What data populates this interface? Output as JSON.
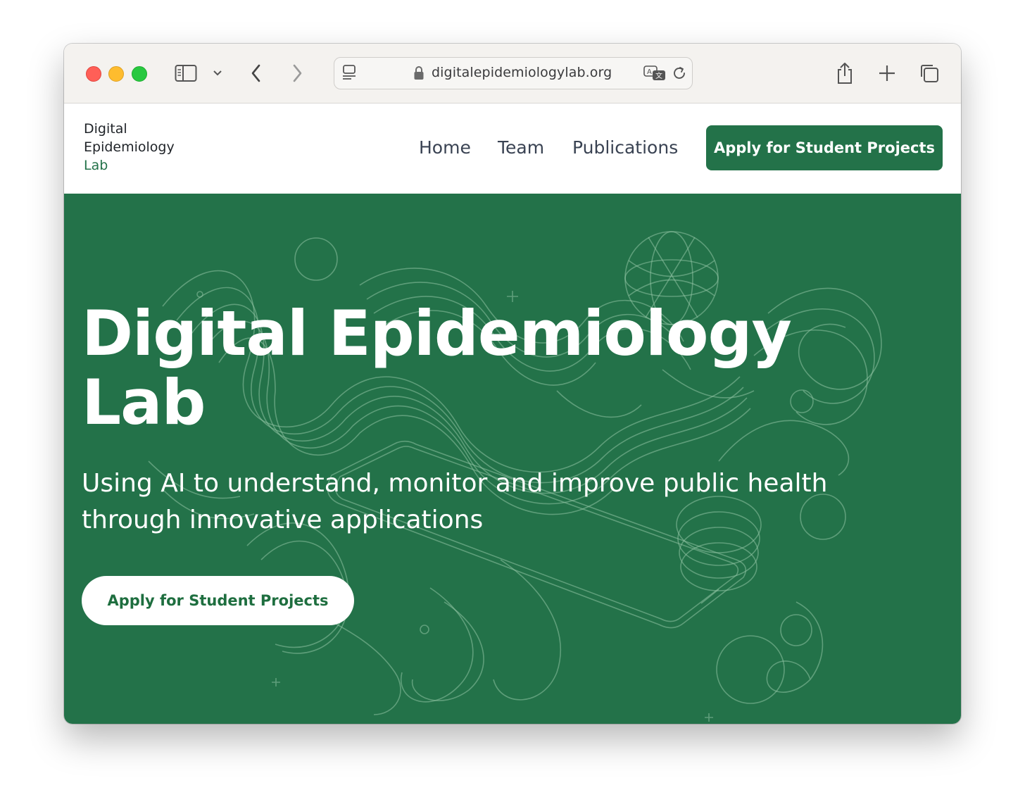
{
  "browser": {
    "url": "digitalepidemiologylab.org",
    "icons": [
      "sidebar-icon",
      "chevron-down-icon",
      "back-icon",
      "forward-icon",
      "reader-icon",
      "lock-icon",
      "translate-icon",
      "reload-icon",
      "share-icon",
      "new-tab-icon",
      "tabs-overview-icon"
    ]
  },
  "site": {
    "brand": {
      "line1": "Digital",
      "line2": "Epidemiology",
      "line3": "Lab"
    },
    "nav": [
      {
        "label": "Home"
      },
      {
        "label": "Team"
      },
      {
        "label": "Publications"
      }
    ],
    "nav_cta": "Apply for Student Projects"
  },
  "hero": {
    "title_line1": "Digital Epidemiology",
    "title_line2": "Lab",
    "subtitle_line1": "Using AI to understand, monitor and improve public health",
    "subtitle_line2": "through innovative applications",
    "cta": "Apply for Student Projects"
  },
  "colors": {
    "brand_green": "#237249",
    "hero_bg": "#237249",
    "nav_text": "#3a4353",
    "chrome_bg": "#f4f2ef"
  }
}
